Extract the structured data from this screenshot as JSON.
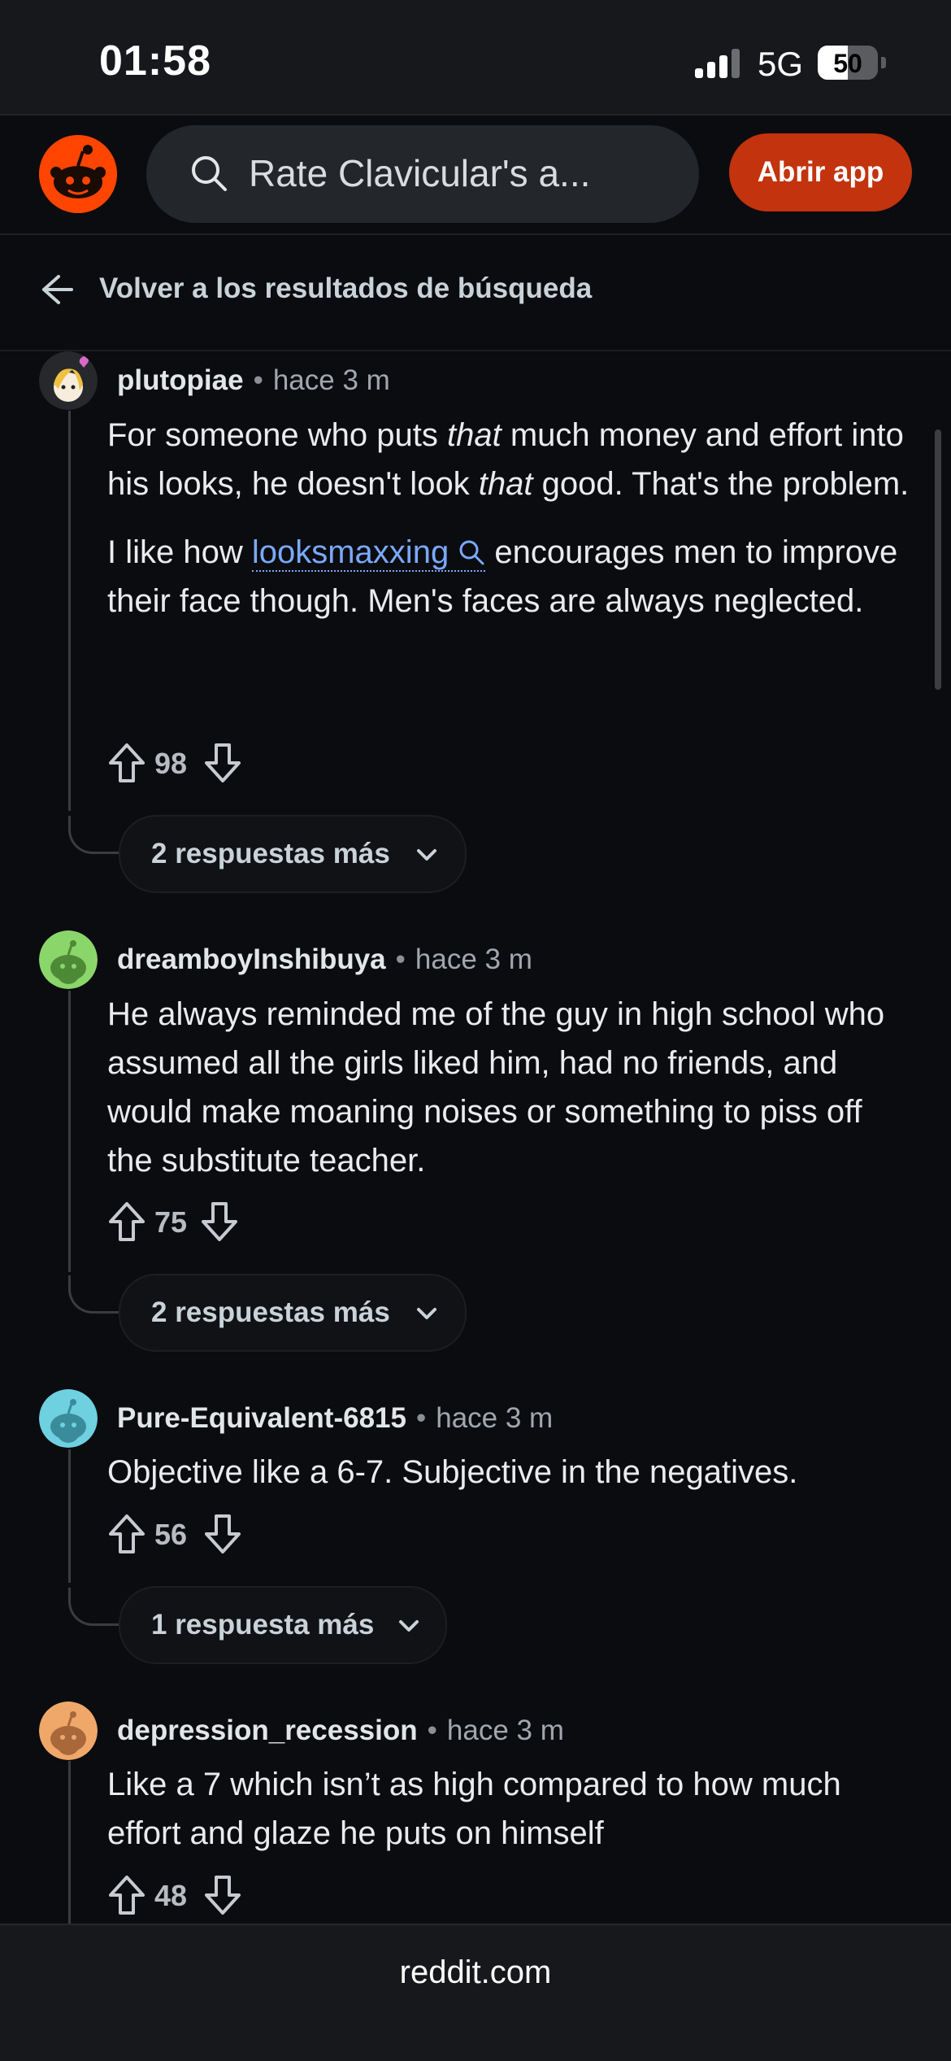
{
  "status_bar": {
    "time": "01:58",
    "network": "5G",
    "battery": "50",
    "battery_level": 0.5
  },
  "header": {
    "search_query": "Rate Clavicular's a...",
    "open_app_label": "Abrir app"
  },
  "back_link": {
    "label": "Volver a los resultados de búsqueda"
  },
  "colors": {
    "accent": "#ff4500",
    "open_app_bg": "#c2330e",
    "link": "#79a9ff",
    "background": "#0b0c0f"
  },
  "comments": [
    {
      "author": "plutopiae",
      "ago": "hace 3 m",
      "avatar_color": "#f3e6c9",
      "p1_a": "For someone who puts ",
      "p1_b": "that",
      "p1_c": " much money and effort into his looks, he doesn't look ",
      "p1_d": "that",
      "p1_e": " good. That's the problem.",
      "p2_a": "I like how ",
      "p2_link": "looksmaxxing",
      "p2_b": " encourages men to improve their face though. Men's faces are always neglected.",
      "score": "98",
      "more_replies": "2 respuestas más"
    },
    {
      "author": "dreamboyInshibuya",
      "ago": "hace 3 m",
      "avatar_color": "#8ad66b",
      "text": "He always reminded me of the guy in high school who assumed all the girls liked him, had no friends, and would make moaning noises or something to piss off the substitute teacher.",
      "score": "75",
      "more_replies": "2 respuestas más"
    },
    {
      "author": "Pure-Equivalent-6815",
      "ago": "hace 3 m",
      "avatar_color": "#6fd0e0",
      "text": "Objective like a 6-7. Subjective in the negatives.",
      "score": "56",
      "more_replies": "1 respuesta más"
    },
    {
      "author": "depression_recession",
      "ago": "hace 3 m",
      "avatar_color": "#f0a86a",
      "text": "Like a 7 which isn’t as high compared to how much effort and glaze he puts on himself",
      "score": "48"
    }
  ],
  "bottom_bar": {
    "url": "reddit.com"
  }
}
